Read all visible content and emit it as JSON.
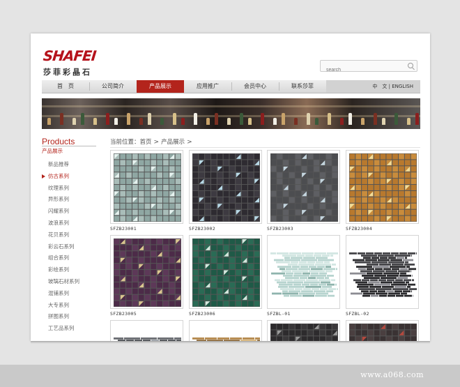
{
  "brand": {
    "logo_text": "SHAFEI",
    "logo_cn": "莎菲彩晶石"
  },
  "search": {
    "placeholder": "search"
  },
  "nav": {
    "items": [
      {
        "label": "首　页"
      },
      {
        "label": "公司简介"
      },
      {
        "label": "产品展示",
        "active": true
      },
      {
        "label": "应用推广"
      },
      {
        "label": "会员中心"
      },
      {
        "label": "联系莎菲"
      }
    ],
    "lang_cn": "中　文",
    "lang_sep": "|",
    "lang_en": "ENGLISH"
  },
  "sidebar": {
    "title": "Products",
    "subtitle": "产品展示",
    "items": [
      {
        "label": "新品推荐"
      },
      {
        "label": "仿古系列",
        "active": true
      },
      {
        "label": "纹理系列"
      },
      {
        "label": "异形系列"
      },
      {
        "label": "闪耀系列"
      },
      {
        "label": "波浪系列"
      },
      {
        "label": "花贝系列"
      },
      {
        "label": "彩云石系列"
      },
      {
        "label": "组合系列"
      },
      {
        "label": "彩绘系列"
      },
      {
        "label": "玻璃石材系列"
      },
      {
        "label": "混铺系列"
      },
      {
        "label": "大专系列"
      },
      {
        "label": "拼图系列"
      },
      {
        "label": "工艺品系列"
      }
    ]
  },
  "breadcrumb": {
    "prefix": "当前位置：",
    "home": "首页",
    "current": "产品展示"
  },
  "products": [
    {
      "code": "SFZB23001",
      "style": "square",
      "base": "#8fa7a3",
      "alt": "#a9bdb9",
      "accent": "#e6f2ef"
    },
    {
      "code": "SFZB23002",
      "style": "square",
      "base": "#2e2b31",
      "alt": "#3d3a41",
      "accent": "#b8d9e6"
    },
    {
      "code": "SFZB23003",
      "style": "square",
      "base": "#4c4d50",
      "alt": "#5e5f63",
      "accent": "#c4d5de"
    },
    {
      "code": "SFZB23004",
      "style": "square",
      "base": "#b8792e",
      "alt": "#c98c3c",
      "accent": "#f1dd9a"
    },
    {
      "code": "SFZB23005",
      "style": "square",
      "base": "#4c2b48",
      "alt": "#5d3858",
      "accent": "#d9c78f"
    },
    {
      "code": "SFZB23006",
      "style": "square",
      "base": "#1f5a47",
      "alt": "#2a6b55",
      "accent": "#d6e6dd"
    },
    {
      "code": "SFZBL-01",
      "style": "strip",
      "base": "#b7d4cf",
      "alt": "#d2e6e2",
      "accent": "#8fb4ad"
    },
    {
      "code": "SFZBL-02",
      "style": "strip",
      "base": "#2b2b2e",
      "alt": "#444448",
      "accent": "#8c8c92"
    },
    {
      "code": "",
      "style": "strip",
      "base": "#4a4d52",
      "alt": "#6a6d72",
      "accent": "#9aa0a6"
    },
    {
      "code": "",
      "style": "strip",
      "base": "#8f6a3a",
      "alt": "#b5894d",
      "accent": "#d8b67a"
    },
    {
      "code": "",
      "style": "square",
      "base": "#2d2b2d",
      "alt": "#3a383a",
      "accent": "#9a9a9a"
    },
    {
      "code": "",
      "style": "square",
      "base": "#3a3233",
      "alt": "#4a3f40",
      "accent": "#b34a3f"
    }
  ],
  "watermark": "www.a068.com"
}
